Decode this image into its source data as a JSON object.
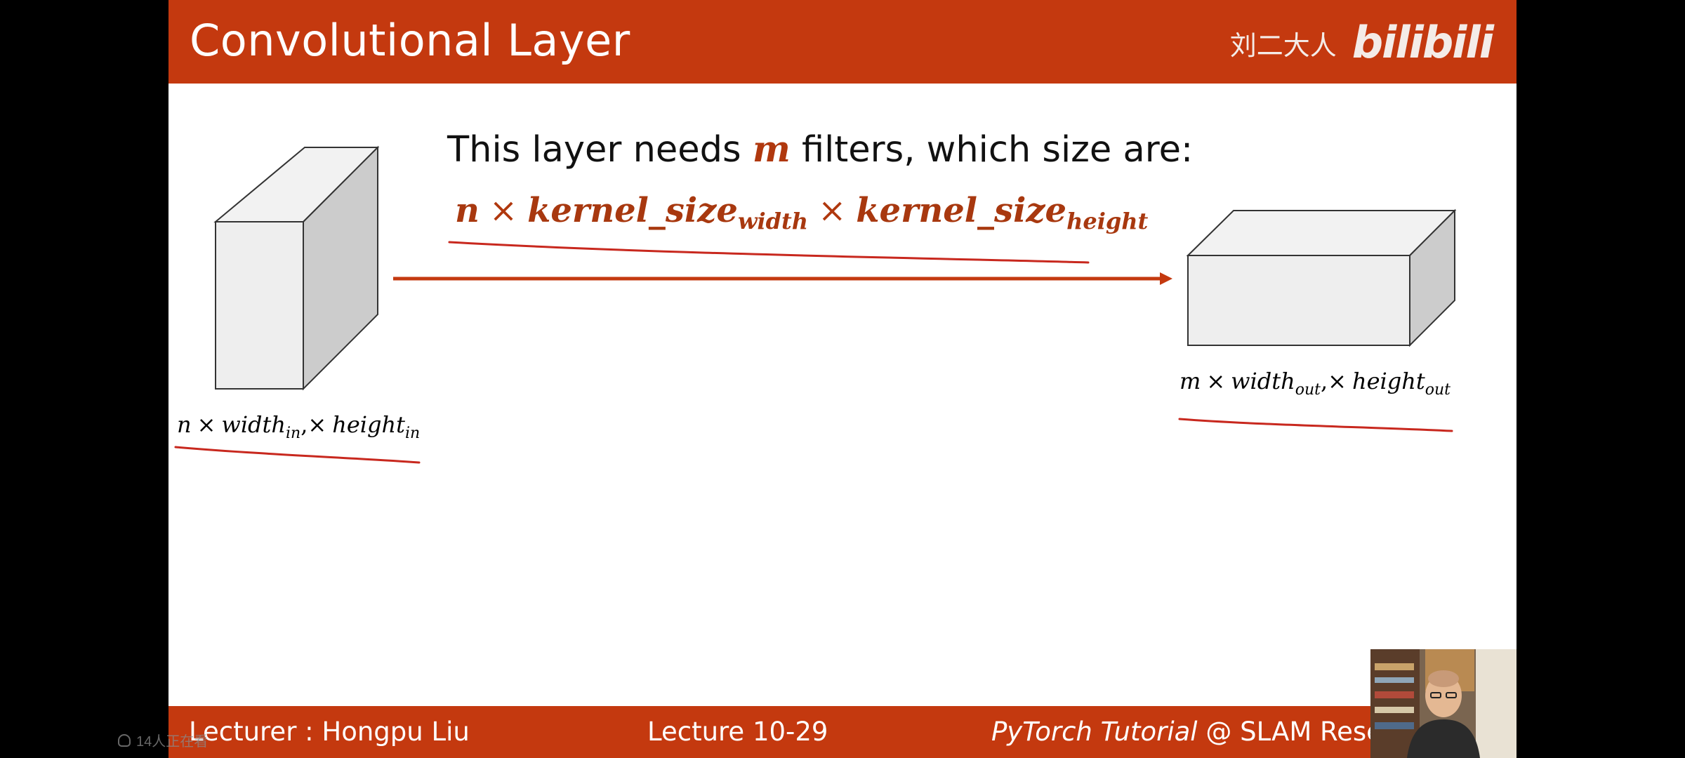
{
  "slide": {
    "title": "Convolutional Layer",
    "watermark_author": "刘二大人",
    "watermark_logo": "bilibili",
    "intro_before": "This layer needs ",
    "intro_var": "m",
    "intro_after": " filters, which size are:",
    "formula": {
      "n": "n",
      "times": "×",
      "kernel": "kernel_size",
      "width_sub": "width",
      "height_sub": "height"
    },
    "input_label": {
      "n": "n",
      "times": "×",
      "width": "width",
      "width_sub": "in",
      "comma_times": ",×",
      "height": "height",
      "height_sub": "in"
    },
    "output_label": {
      "m": "m",
      "times": "×",
      "width": "width",
      "width_sub": "out",
      "comma_times": ",×",
      "height": "height",
      "height_sub": "out"
    }
  },
  "footer": {
    "lecturer": "Lecturer : Hongpu Liu",
    "lecture": "Lecture 10-29",
    "brand_italic": "PyTorch Tutorial",
    "brand_rest": " @ SLAM Resea"
  },
  "overlay": {
    "viewer_count": "14人正在看"
  },
  "colors": {
    "accent": "#c4390f",
    "formula": "#a8380f",
    "underline": "#c8281e"
  }
}
